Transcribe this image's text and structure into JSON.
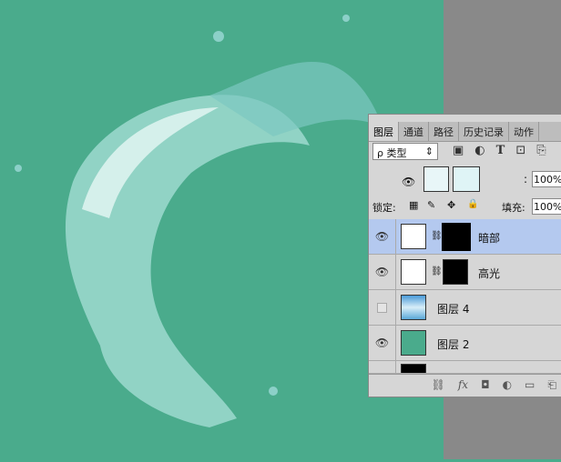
{
  "tabs": [
    "图层",
    "通道",
    "路径",
    "历史记录",
    "动作"
  ],
  "filter": {
    "label": "ρ 类型",
    "arrow": "⇕"
  },
  "filter_icons": [
    "▣",
    "◐",
    "T",
    "⊡",
    "⎘"
  ],
  "ghost": {
    "opacity": "100%"
  },
  "lock": {
    "label": "锁定:",
    "fill_label": "填充:",
    "fill": "100%",
    "opacity_colon": ":"
  },
  "lock_icons": [
    "▦",
    "✎",
    "✥",
    "🔒"
  ],
  "layers": [
    {
      "name": "暗部",
      "visible": true,
      "selected": true
    },
    {
      "name": "高光",
      "visible": true,
      "selected": false
    },
    {
      "name": "图层 4",
      "visible": false,
      "selected": false
    },
    {
      "name": "图层 2",
      "visible": true,
      "selected": false
    }
  ],
  "bottom_icons": [
    "⛓",
    "fx",
    "◘",
    "◐",
    "▭",
    "⎗"
  ],
  "colors": {
    "canvas": "#4aab8c",
    "pasteboard": "#898989",
    "selected": "#b4c9ef"
  }
}
